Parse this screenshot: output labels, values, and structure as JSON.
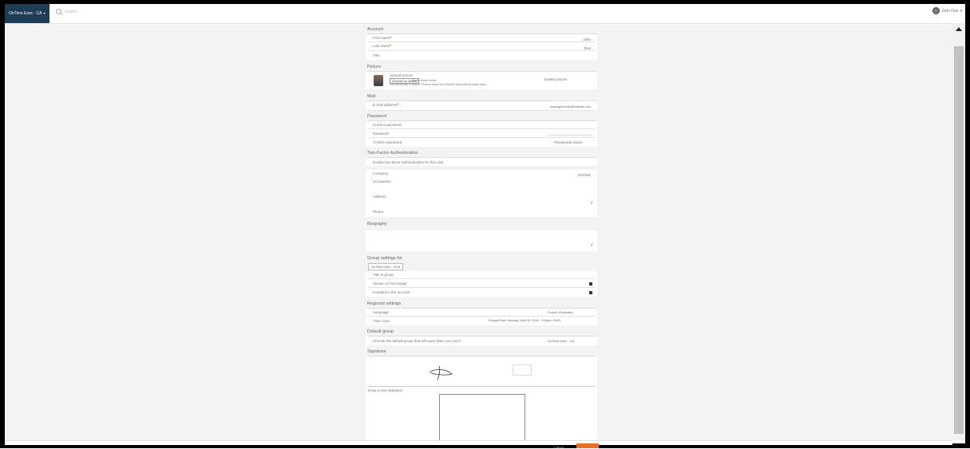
{
  "app": {
    "company": "OnTime Exec - CA",
    "search_placeholder": "Search",
    "user_name": "John Doe"
  },
  "account": {
    "title": "Account",
    "first_name_label": "First name",
    "first_name_value": "John",
    "last_name_label": "Last name",
    "last_name_value": "Doe",
    "title_label": "Title"
  },
  "picture": {
    "title": "Picture",
    "upload_label": "Upload picture",
    "choose_button": "Choose un fichier",
    "no_file": "Aucun fichier choisi",
    "hint": "Your actual face or picture. Pictures larger than 300x300 pixels will be scaled down",
    "delete_label": "Delete picture"
  },
  "mail": {
    "title": "Mail",
    "email_label": "E-mail address",
    "email_value": "kwengohnmar@hotmail.com"
  },
  "password": {
    "title": "Password",
    "current_label": "Current password",
    "password_label": "Password",
    "confirm_label": "Confirm password",
    "match_text": "Passwords match"
  },
  "two_factor": {
    "title": "Two-Factor Authentication",
    "enable_label": "Enable two factor authentication for this user"
  },
  "profile": {
    "company_label": "Company",
    "company_value": "OnTime",
    "occupation_label": "Occupation",
    "address_label": "Address",
    "phone_label": "Phone"
  },
  "biography": {
    "title": "Biography"
  },
  "group_settings": {
    "title": "Group settings for",
    "group_select": "OnTime Exec - CA",
    "title_in_group_label": "Title in group",
    "shown_label": "Shown on homepage",
    "included_label": "Included in the account"
  },
  "regional": {
    "title": "Regional settings",
    "language_label": "Language",
    "language_value": "French (Français)",
    "timezone_label": "Time zone",
    "timezone_value": "Europe/Paris: Monday, April 30, 2018 - 3:28pm +0200"
  },
  "default_group": {
    "title": "Default group",
    "choose_label": "Choose the default group that will open when you log in",
    "value": "OnTime Exec - CA"
  },
  "signature": {
    "title": "Signature",
    "draw_label": "Draw a new signature"
  },
  "footer": {
    "cancel": "Cancel"
  }
}
